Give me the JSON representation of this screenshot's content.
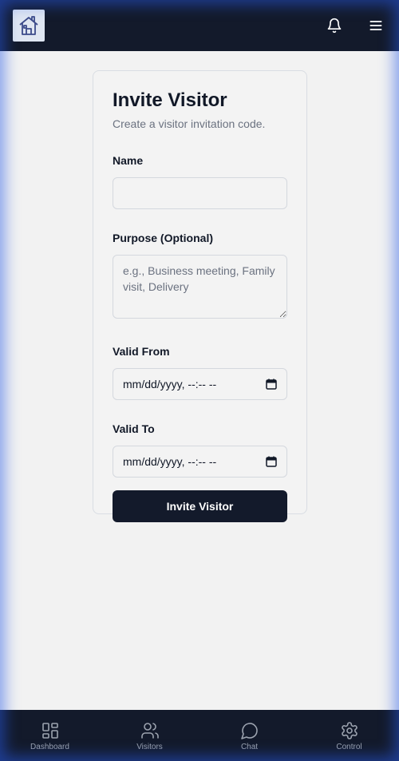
{
  "header": {
    "logo_icon": "house-logo-icon",
    "notifications_icon": "bell-icon",
    "menu_icon": "hamburger-menu-icon"
  },
  "form": {
    "title": "Invite Visitor",
    "subtitle": "Create a visitor invitation code.",
    "name_label": "Name",
    "name_value": "",
    "purpose_label": "Purpose (Optional)",
    "purpose_placeholder": "e.g., Business meeting, Family visit, Delivery",
    "valid_from_label": "Valid From",
    "valid_from_value": "mm/dd/yyyy, --:-- --",
    "valid_to_label": "Valid To",
    "valid_to_value": "mm/dd/yyyy, --:-- --",
    "submit_label": "Invite Visitor"
  },
  "bottom_nav": {
    "items": [
      {
        "label": "Dashboard",
        "icon": "grid-icon"
      },
      {
        "label": "Visitors",
        "icon": "users-icon"
      },
      {
        "label": "Chat",
        "icon": "chat-bubble-icon"
      },
      {
        "label": "Control",
        "icon": "gear-icon"
      }
    ]
  },
  "colors": {
    "nav_bg": "#131a2b",
    "page_bg": "#f2f2f2",
    "accent_glow": "#285ae6"
  }
}
